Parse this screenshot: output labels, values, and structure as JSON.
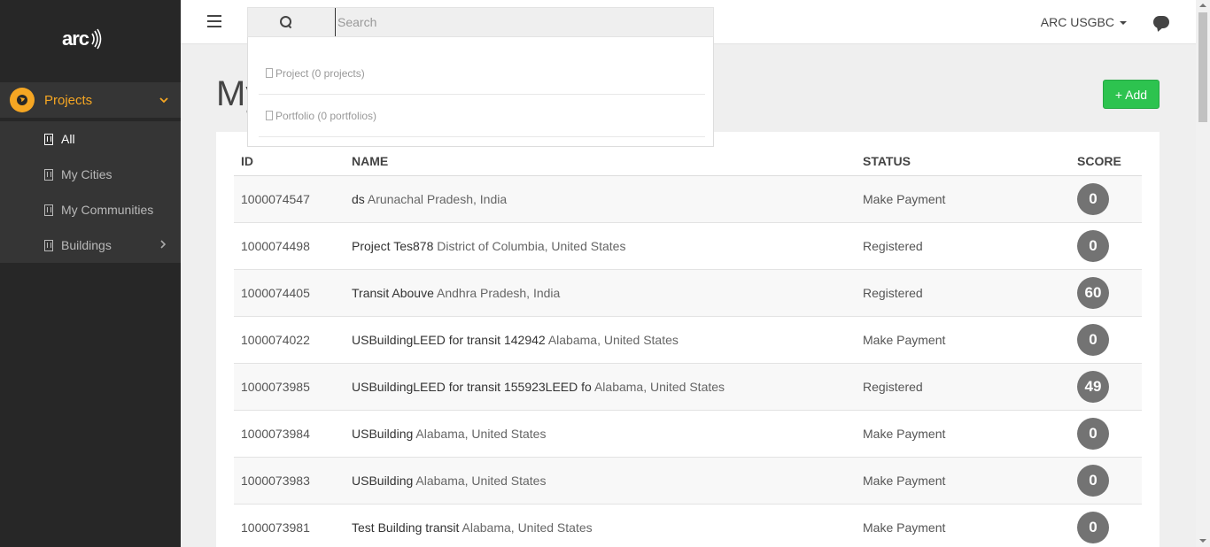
{
  "app": {
    "logo_text": "arc",
    "user_menu": "ARC USGBC",
    "search_placeholder": "Search"
  },
  "sidebar": {
    "projects_label": "Projects",
    "items": [
      {
        "label": "All"
      },
      {
        "label": "My Cities"
      },
      {
        "label": "My Communities"
      },
      {
        "label": "Buildings"
      }
    ]
  },
  "search_dropdown": {
    "options": [
      {
        "label": "Project (0 projects)"
      },
      {
        "label": "Portfolio (0 portfolios)"
      }
    ]
  },
  "main": {
    "title": "My",
    "add_button": "+ Add",
    "columns": [
      "ID",
      "NAME",
      "STATUS",
      "SCORE"
    ],
    "rows": [
      {
        "id": "1000074547",
        "name": "ds",
        "location": "Arunachal Pradesh, India",
        "status": "Make Payment",
        "score": "0"
      },
      {
        "id": "1000074498",
        "name": "Project Tes878",
        "location": "District of Columbia, United States",
        "status": "Registered",
        "score": "0"
      },
      {
        "id": "1000074405",
        "name": "Transit Abouve",
        "location": "Andhra Pradesh, India",
        "status": "Registered",
        "score": "60"
      },
      {
        "id": "1000074022",
        "name": "USBuildingLEED for transit 142942",
        "location": "Alabama, United States",
        "status": "Make Payment",
        "score": "0"
      },
      {
        "id": "1000073985",
        "name": "USBuildingLEED for transit 155923LEED fo",
        "location": "Alabama, United States",
        "status": "Registered",
        "score": "49"
      },
      {
        "id": "1000073984",
        "name": "USBuilding",
        "location": "Alabama, United States",
        "status": "Make Payment",
        "score": "0"
      },
      {
        "id": "1000073983",
        "name": "USBuilding",
        "location": "Alabama, United States",
        "status": "Make Payment",
        "score": "0"
      },
      {
        "id": "1000073981",
        "name": "Test Building transit",
        "location": "Alabama, United States",
        "status": "Make Payment",
        "score": "0"
      }
    ]
  },
  "colors": {
    "sidebar_bg": "#272727",
    "accent": "#f5a623",
    "add_button": "#2dc34f",
    "score_badge": "#737373"
  }
}
